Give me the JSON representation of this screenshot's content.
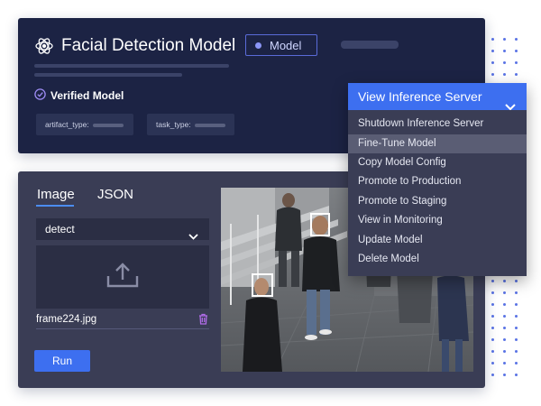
{
  "model_card": {
    "title": "Facial Detection Model",
    "badge": "Model",
    "verified_label": "Verified Model",
    "tags": [
      {
        "label": "artifact_type:"
      },
      {
        "label": "task_type:"
      }
    ]
  },
  "inference": {
    "tabs": [
      {
        "label": "Image",
        "active": true
      },
      {
        "label": "JSON",
        "active": false
      }
    ],
    "task_select": "detect",
    "file_name": "frame224.jpg",
    "run_label": "Run"
  },
  "dropdown": {
    "title": "View Inference Server",
    "items": [
      "Shutdown Inference Server",
      "Fine-Tune Model",
      "Copy Model Config",
      "Promote to Production",
      "Promote to Staging",
      "View in Monitoring",
      "Update Model",
      "Delete Model"
    ],
    "highlighted_item": "Fine-Tune Model"
  },
  "icons": {
    "model": "atom-icon",
    "verified": "check-circle-icon",
    "upload": "upload-icon",
    "delete": "trash-icon",
    "chevron": "chevron-down-icon"
  },
  "colors": {
    "accent": "#3d6ff0",
    "card_dark": "#1c2344",
    "card_gray": "#3a3d55",
    "trash": "#b06ce8"
  }
}
